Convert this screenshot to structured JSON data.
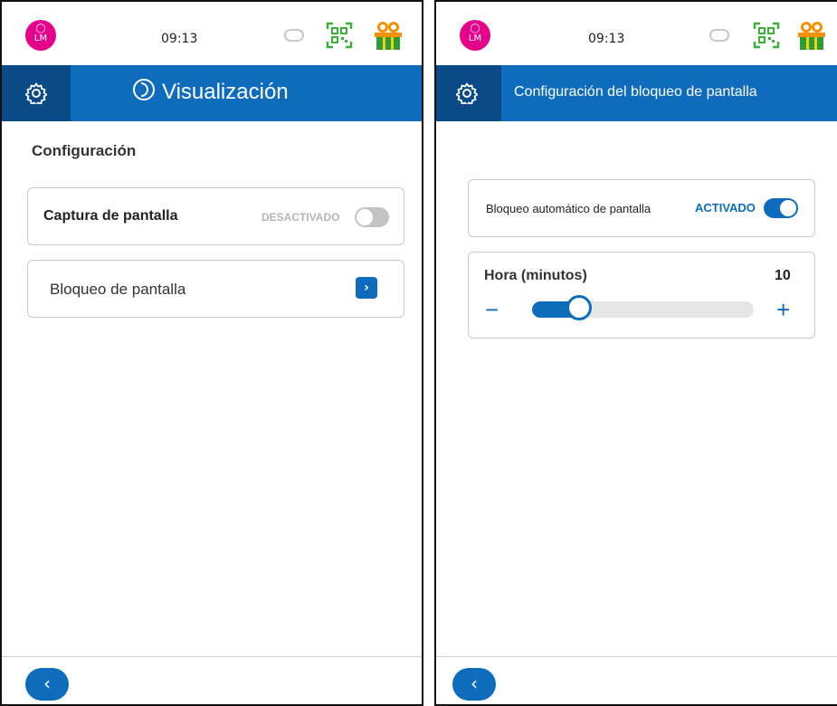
{
  "left": {
    "status": {
      "avatar_initials": "LM",
      "time": "09:13"
    },
    "header": {
      "title": "Visualización"
    },
    "section_title": "Configuración",
    "screenshot_item": {
      "label": "Captura de pantalla",
      "state": "DESACTIVADO"
    },
    "lock_item": {
      "label": "Bloqueo de pantalla"
    }
  },
  "right": {
    "status": {
      "avatar_initials": "LM",
      "time": "09:13"
    },
    "header": {
      "title": "Configuración del bloqueo de pantalla"
    },
    "auto_lock": {
      "label": "Bloqueo automático de pantalla",
      "state": "ACTIVADO"
    },
    "timeout": {
      "label": "Hora (minutos)",
      "value": "10",
      "fraction": 0.09,
      "minus": "−",
      "plus": "+"
    }
  },
  "colors": {
    "brand_blue": "#0f6cbd",
    "brand_dark": "#0a4a86",
    "avatar_pink": "#e5008a",
    "qr_green": "#3bb03b",
    "gift_orange": "#f39200",
    "gift_green": "#2e9b3a"
  },
  "icons": [
    "person-icon",
    "sync-icon",
    "qr-code-icon",
    "gift-icon",
    "gear-icon",
    "display-icon",
    "chevron-right-icon",
    "chevron-left-icon",
    "minus-icon",
    "plus-icon"
  ]
}
